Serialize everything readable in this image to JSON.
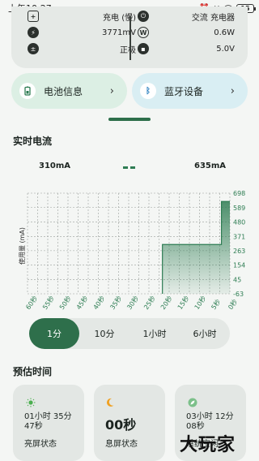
{
  "status_bar": {
    "time": "上午10:27",
    "battery_level": "15"
  },
  "info": {
    "rows": [
      {
        "left_value": "充电 (慢)",
        "right_value": "交流 充电器"
      },
      {
        "left_value": "3771mV",
        "right_value": "0.6W"
      },
      {
        "left_value": "正极",
        "right_value": "5.0V"
      }
    ],
    "icons": [
      "charging-plug-icon",
      "ac-plug-icon",
      "bolt-icon",
      "watt-icon",
      "battery-polarity-icon",
      "voltage-plug-icon"
    ]
  },
  "quick": {
    "battery_info": "电池信息",
    "bluetooth": "蓝牙设备",
    "chevron": "›"
  },
  "realtime": {
    "title": "实时电流",
    "min_value": "310mA",
    "max_value": "635mA"
  },
  "chart_data": {
    "type": "area",
    "ylabel": "使用量 (mA)",
    "yticks": [
      698,
      589,
      480,
      371,
      263,
      154,
      45,
      -63
    ],
    "ylim": [
      -63,
      698
    ],
    "xticks": [
      "60秒",
      "55秒",
      "50秒",
      "45秒",
      "40秒",
      "35秒",
      "30秒",
      "25秒",
      "20秒",
      "15秒",
      "10秒",
      "5秒",
      "0秒"
    ],
    "x": [
      -60,
      -55,
      -50,
      -45,
      -40,
      -35,
      -30,
      -25,
      -20,
      -15,
      -10,
      -5,
      -2.5,
      -2.5,
      -0.5,
      0
    ],
    "values": [
      null,
      null,
      null,
      null,
      null,
      null,
      null,
      null,
      310,
      310,
      310,
      310,
      310,
      635,
      635,
      635
    ],
    "color": "#2e7d53"
  },
  "range": {
    "options": [
      "1分",
      "10分",
      "1小时",
      "6小时"
    ],
    "selected": "1分"
  },
  "estimate": {
    "title": "预估时间",
    "cards": [
      {
        "icon": "sun-icon",
        "value": "01小时 35分\n47秒",
        "label": "亮屏状态"
      },
      {
        "icon": "moon-icon",
        "value": "00秒",
        "label": "息屏状态"
      },
      {
        "icon": "leaf-icon",
        "value": "03小时 12分\n08秒",
        "label": "系统空闲"
      }
    ]
  },
  "watermark": "大玩家"
}
